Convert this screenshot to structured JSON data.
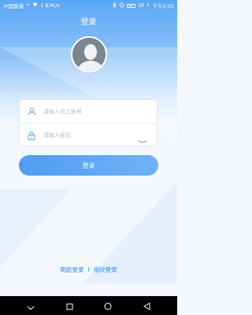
{
  "status_bar": {
    "carrier": "中国联通",
    "signal": "⁴⁶",
    "speed": "1.83K/s",
    "battery_pct": "30",
    "time": "下午2:55"
  },
  "header": {
    "title": "登录"
  },
  "form": {
    "username_placeholder": "请输入员工账号",
    "password_placeholder": "请输入密码"
  },
  "login_button_label": "登录",
  "alt_login": {
    "face_label": "刷脸登录",
    "separator": "I",
    "fingerprint_label": "指纹登录"
  },
  "colors": {
    "accent": "#4f9cf2",
    "link": "#2f87e6"
  }
}
